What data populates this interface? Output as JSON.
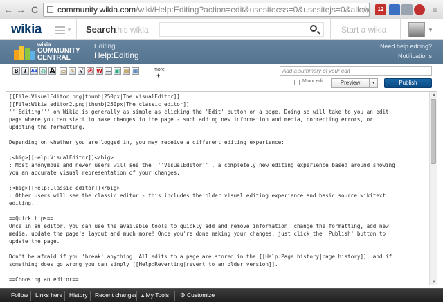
{
  "browser": {
    "url_host": "community.wikia.com",
    "url_path": "/wiki/Help:Editing?action=edit&usesitecss=0&usesitejs=0&allowusercss=0&allc",
    "back_label": "←",
    "forward_label": "→",
    "reload_label": "C",
    "star_label": "☆",
    "ext_badge": "12"
  },
  "header": {
    "logo": "wikia",
    "search_label": "Search",
    "search_scope": "this wikia",
    "search_placeholder": "",
    "start_wiki": "Start a wikia"
  },
  "banner": {
    "logo_small": "wikia",
    "logo_line1": "COMMUNITY",
    "logo_line2": "CENTRAL",
    "action_label": "Editing",
    "page_title": "Help:Editing",
    "need_help": "Need help editing?",
    "notifications": "Notifications"
  },
  "toolbar": {
    "buttons": [
      {
        "glyph": "B"
      },
      {
        "glyph": "I"
      },
      {
        "glyph": "Ab"
      },
      {
        "glyph": "◍"
      },
      {
        "glyph": "A"
      },
      {
        "glyph": "▭"
      },
      {
        "glyph": "✎"
      },
      {
        "glyph": "√"
      },
      {
        "glyph": "ⓦ"
      },
      {
        "glyph": "W"
      },
      {
        "glyph": "—"
      },
      {
        "glyph": "▣"
      },
      {
        "glyph": "▤"
      },
      {
        "glyph": "▦"
      }
    ],
    "more_label": "more",
    "more_plus": "+",
    "summary_placeholder": "Add a summary of your edit",
    "minor_edit_label": "Minor edit",
    "preview_label": "Preview",
    "preview_chevron": "▾",
    "publish_label": "Publish"
  },
  "editor": {
    "lines": [
      "[[File:VisualEditor.png|thumb|250px|The VisualEditor]]",
      "[[File:Wikia_editor2.png|thumb|250px|The classic editor]]",
      "'''Editing''' on Wikia is generally as simple as clicking the 'Edit' button on a page. Doing so will take to you an edit",
      "page where you can start to make changes to the page - such adding new information and media, correcting errors, or",
      "updating the formatting.",
      "",
      "Depending on whether you are logged in, you may receive a different editing experience:",
      "",
      ";<big>[[Help:VisualEditor]]</big>",
      ": Most anonymous and newer users will see the '''VisualEditor''', a completely new editing experience based around showing",
      "you an accurate visual representation of your changes.",
      "",
      ";<big>[[Help:Classic editor]]</big>",
      ": Other users will see the classic editor - this includes the older visual editing experience and basic source wikitext",
      "editing.",
      "",
      "==Quick tips==",
      "Once in an editor, you can use the available tools to quickly add and remove information, change the formatting, add new",
      "media, update the page's layout and much more! Once you're done making your changes, just click the 'Publish' button to",
      "update the page.",
      "",
      "Don't be afraid if you 'break' anything. All edits to a page are stored in the [[Help:Page history|page history]], and if",
      "something does go wrong you can simply [[Help:Reverting|revert to an older version]].",
      "",
      "==Choosing an editor=="
    ]
  },
  "bottom_bar": {
    "items": [
      "Follow",
      "Links here",
      "History",
      "Recent changes",
      "My Tools",
      "Customize"
    ],
    "mytools_arrow": "▴",
    "customize_icon": "⚙"
  }
}
